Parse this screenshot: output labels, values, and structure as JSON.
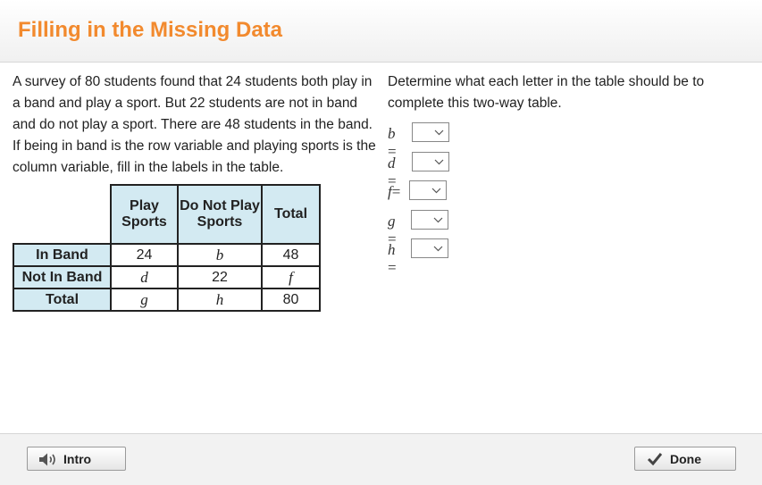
{
  "header": {
    "title": "Filling in the Missing Data"
  },
  "problem_text": "A survey of 80 students found that 24 students both play in a band and play a sport. But 22 students are not in band and do not play a sport. There are 48 students in the band. If being in band is the row variable and playing sports is the column variable, fill in the labels in the table.",
  "instructions": "Determine what each letter in the table should be to complete this two-way table.",
  "table": {
    "col_headers": [
      "Play Sports",
      "Do Not Play Sports",
      "Total"
    ],
    "rows": [
      {
        "label": "In Band",
        "cells": [
          "24",
          "b",
          "48"
        ]
      },
      {
        "label": "Not In Band",
        "cells": [
          "d",
          "22",
          "f"
        ]
      },
      {
        "label": "Total",
        "cells": [
          "g",
          "h",
          "80"
        ]
      }
    ]
  },
  "answers": [
    {
      "var": "b",
      "eq": "=",
      "value": ""
    },
    {
      "var": "d",
      "eq": "=",
      "value": ""
    },
    {
      "var": "f",
      "eq": "=",
      "value": ""
    },
    {
      "var": "g",
      "eq": "=",
      "value": ""
    },
    {
      "var": "h",
      "eq": "=",
      "value": ""
    }
  ],
  "footer": {
    "intro_label": "Intro",
    "done_label": "Done",
    "intro_icon": "speaker-icon",
    "done_icon": "checkmark-icon"
  }
}
